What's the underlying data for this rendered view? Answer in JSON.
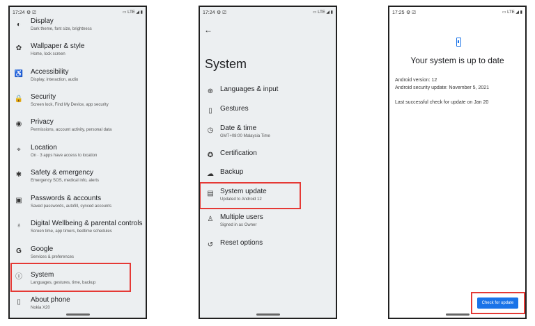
{
  "phone1": {
    "status": {
      "time": "17:24",
      "left_icons": "⚙ ⎚",
      "right_icons": "▭ LTE ◢ ▮"
    },
    "items": [
      {
        "title": "Display",
        "subtitle": "Dark theme, font size, brightness",
        "icon": "◐"
      },
      {
        "title": "Wallpaper & style",
        "subtitle": "Home, lock screen",
        "icon": "✿"
      },
      {
        "title": "Accessibility",
        "subtitle": "Display, interaction, audio",
        "icon": "♿"
      },
      {
        "title": "Security",
        "subtitle": "Screen lock, Find My Device, app security",
        "icon": "🔒"
      },
      {
        "title": "Privacy",
        "subtitle": "Permissions, account activity, personal data",
        "icon": "◉"
      },
      {
        "title": "Location",
        "subtitle": "On · 3 apps have access to location",
        "icon": "⌖"
      },
      {
        "title": "Safety & emergency",
        "subtitle": "Emergency SOS, medical info, alerts",
        "icon": "✱"
      },
      {
        "title": "Passwords & accounts",
        "subtitle": "Saved passwords, autofill, synced accounts",
        "icon": "▣"
      },
      {
        "title": "Digital Wellbeing & parental controls",
        "subtitle": "Screen time, app timers, bedtime schedules",
        "icon": "♁"
      },
      {
        "title": "Google",
        "subtitle": "Services & preferences",
        "icon": "G"
      },
      {
        "title": "System",
        "subtitle": "Languages, gestures, time, backup",
        "icon": "ⓘ"
      },
      {
        "title": "About phone",
        "subtitle": "Nokia X20",
        "icon": "▯"
      }
    ]
  },
  "phone2": {
    "status": {
      "time": "17:24",
      "left_icons": "⚙ ⎚",
      "right_icons": "▭ LTE ◢ ▮"
    },
    "back": "←",
    "title": "System",
    "items": [
      {
        "title": "Languages & input",
        "subtitle": "",
        "icon": "⊕"
      },
      {
        "title": "Gestures",
        "subtitle": "",
        "icon": "▯"
      },
      {
        "title": "Date & time",
        "subtitle": "GMT+08:00 Malaysia Time",
        "icon": "◷"
      },
      {
        "title": "Certification",
        "subtitle": "",
        "icon": "✪"
      },
      {
        "title": "Backup",
        "subtitle": "",
        "icon": "☁"
      },
      {
        "title": "System update",
        "subtitle": "Updated to Android 12",
        "icon": "▤"
      },
      {
        "title": "Multiple users",
        "subtitle": "Signed in as Owner",
        "icon": "♙"
      },
      {
        "title": "Reset options",
        "subtitle": "",
        "icon": "↺"
      }
    ]
  },
  "phone3": {
    "status": {
      "time": "17:25",
      "left_icons": "⚙ ⎚",
      "right_icons": "▭ LTE ◢ ▮"
    },
    "title": "Your system is up to date",
    "android_version": "Android version: 12",
    "security_update": "Android security update: November 5, 2021",
    "last_check": "Last successful check for update on Jan 20",
    "button": "Check for update"
  },
  "colors": {
    "highlight": "#e53935",
    "accent": "#1a73e8"
  }
}
